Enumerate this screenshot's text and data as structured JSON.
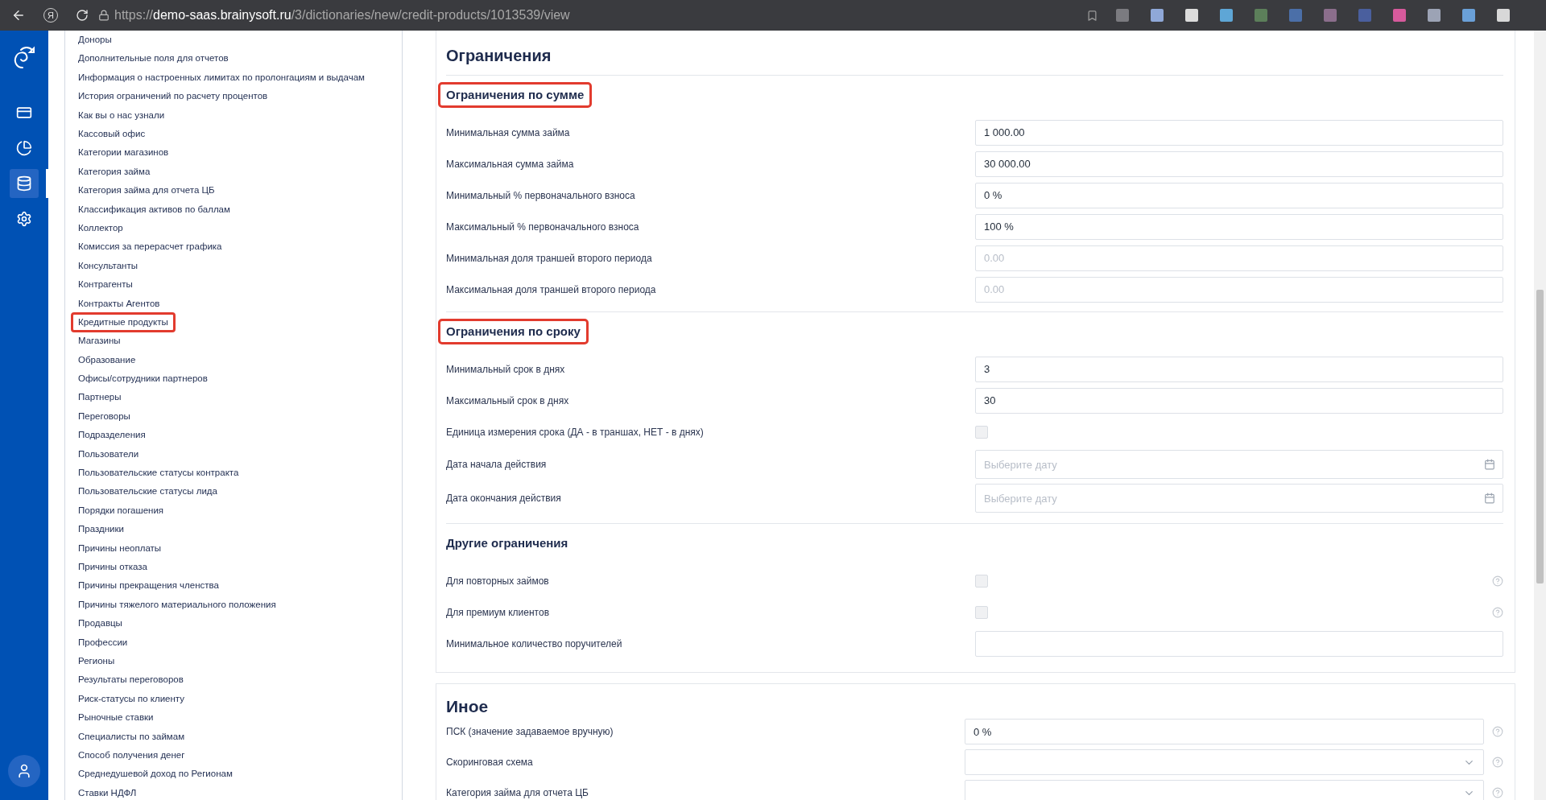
{
  "browser": {
    "logo_letter": "Я",
    "url_scheme": "https://",
    "url_host": "demo-saas.brainysoft.ru",
    "url_path": "/3/dictionaries/new/credit-products/1013539/view"
  },
  "rail": {
    "items": [
      {
        "kind": "cards",
        "selected": false
      },
      {
        "kind": "reports",
        "selected": false
      },
      {
        "kind": "dictionaries",
        "selected": true
      },
      {
        "kind": "settings",
        "selected": false
      }
    ]
  },
  "dictionary_list": [
    {
      "label": "Доноры",
      "highlighted": false
    },
    {
      "label": "Дополнительные поля для отчетов",
      "highlighted": false
    },
    {
      "label": "Информация о настроенных лимитах по пролонгациям и выдачам",
      "highlighted": false
    },
    {
      "label": "История ограничений по расчету процентов",
      "highlighted": false
    },
    {
      "label": "Как вы о нас узнали",
      "highlighted": false
    },
    {
      "label": "Кассовый офис",
      "highlighted": false
    },
    {
      "label": "Категории магазинов",
      "highlighted": false
    },
    {
      "label": "Категория займа",
      "highlighted": false
    },
    {
      "label": "Категория займа для отчета ЦБ",
      "highlighted": false
    },
    {
      "label": "Классификация активов по баллам",
      "highlighted": false
    },
    {
      "label": "Коллектор",
      "highlighted": false
    },
    {
      "label": "Комиссия за перерасчет графика",
      "highlighted": false
    },
    {
      "label": "Консультанты",
      "highlighted": false
    },
    {
      "label": "Контрагенты",
      "highlighted": false
    },
    {
      "label": "Контракты Агентов",
      "highlighted": false
    },
    {
      "label": "Кредитные продукты",
      "highlighted": true
    },
    {
      "label": "Магазины",
      "highlighted": false
    },
    {
      "label": "Образование",
      "highlighted": false
    },
    {
      "label": "Офисы/сотрудники партнеров",
      "highlighted": false
    },
    {
      "label": "Партнеры",
      "highlighted": false
    },
    {
      "label": "Переговоры",
      "highlighted": false
    },
    {
      "label": "Подразделения",
      "highlighted": false
    },
    {
      "label": "Пользователи",
      "highlighted": false
    },
    {
      "label": "Пользовательские статусы контракта",
      "highlighted": false
    },
    {
      "label": "Пользовательские статусы лида",
      "highlighted": false
    },
    {
      "label": "Порядки погашения",
      "highlighted": false
    },
    {
      "label": "Праздники",
      "highlighted": false
    },
    {
      "label": "Причины неоплаты",
      "highlighted": false
    },
    {
      "label": "Причины отказа",
      "highlighted": false
    },
    {
      "label": "Причины прекращения членства",
      "highlighted": false
    },
    {
      "label": "Причины тяжелого материального положения",
      "highlighted": false
    },
    {
      "label": "Продавцы",
      "highlighted": false
    },
    {
      "label": "Профессии",
      "highlighted": false
    },
    {
      "label": "Регионы",
      "highlighted": false
    },
    {
      "label": "Результаты переговоров",
      "highlighted": false
    },
    {
      "label": "Риск-статусы по клиенту",
      "highlighted": false
    },
    {
      "label": "Рыночные ставки",
      "highlighted": false
    },
    {
      "label": "Специалисты по займам",
      "highlighted": false
    },
    {
      "label": "Способ получения денег",
      "highlighted": false
    },
    {
      "label": "Среднедушевой доход по Регионам",
      "highlighted": false
    },
    {
      "label": "Ставки НДФЛ",
      "highlighted": false
    }
  ],
  "limits_card": {
    "title": "Ограничения",
    "groups": [
      {
        "title": "Ограничения по сумме",
        "highlighted": true,
        "rows": [
          {
            "kind": "input",
            "label": "Минимальная сумма займа",
            "value": "1 000.00"
          },
          {
            "kind": "input",
            "label": "Максимальная сумма займа",
            "value": "30 000.00"
          },
          {
            "kind": "input",
            "label": "Минимальный % первоначального взноса",
            "value": "0 %"
          },
          {
            "kind": "input",
            "label": "Максимальный % первоначального взноса",
            "value": "100 %"
          },
          {
            "kind": "input",
            "label": "Минимальная доля траншей второго периода",
            "placeholder": "0.00"
          },
          {
            "kind": "input",
            "label": "Максимальная доля траншей второго периода",
            "placeholder": "0.00"
          }
        ]
      },
      {
        "title": "Ограничения по сроку",
        "highlighted": true,
        "rows": [
          {
            "kind": "input",
            "label": "Минимальный срок в днях",
            "value": "3"
          },
          {
            "kind": "input",
            "label": "Максимальный срок в днях",
            "value": "30"
          },
          {
            "kind": "checkbox",
            "label": "Единица измерения срока (ДА - в траншах, НЕТ - в днях)",
            "checked": false
          },
          {
            "kind": "date",
            "label": "Дата начала действия",
            "placeholder": "Выберите дату"
          },
          {
            "kind": "date",
            "label": "Дата окончания действия",
            "placeholder": "Выберите дату"
          }
        ]
      },
      {
        "title": "Другие ограничения",
        "highlighted": false,
        "rows": [
          {
            "kind": "checkbox",
            "label": "Для повторных займов",
            "checked": false,
            "help": true
          },
          {
            "kind": "checkbox",
            "label": "Для премиум клиентов",
            "checked": false,
            "help": true
          },
          {
            "kind": "input",
            "label": "Минимальное количество поручителей"
          }
        ]
      }
    ]
  },
  "other_card": {
    "title": "Иное",
    "rows": [
      {
        "kind": "input",
        "label": "ПСК (значение задаваемое вручную)",
        "value": "0 %"
      },
      {
        "kind": "select",
        "label": "Скоринговая схема"
      },
      {
        "kind": "select",
        "label": "Категория займа для отчета ЦБ"
      }
    ]
  }
}
